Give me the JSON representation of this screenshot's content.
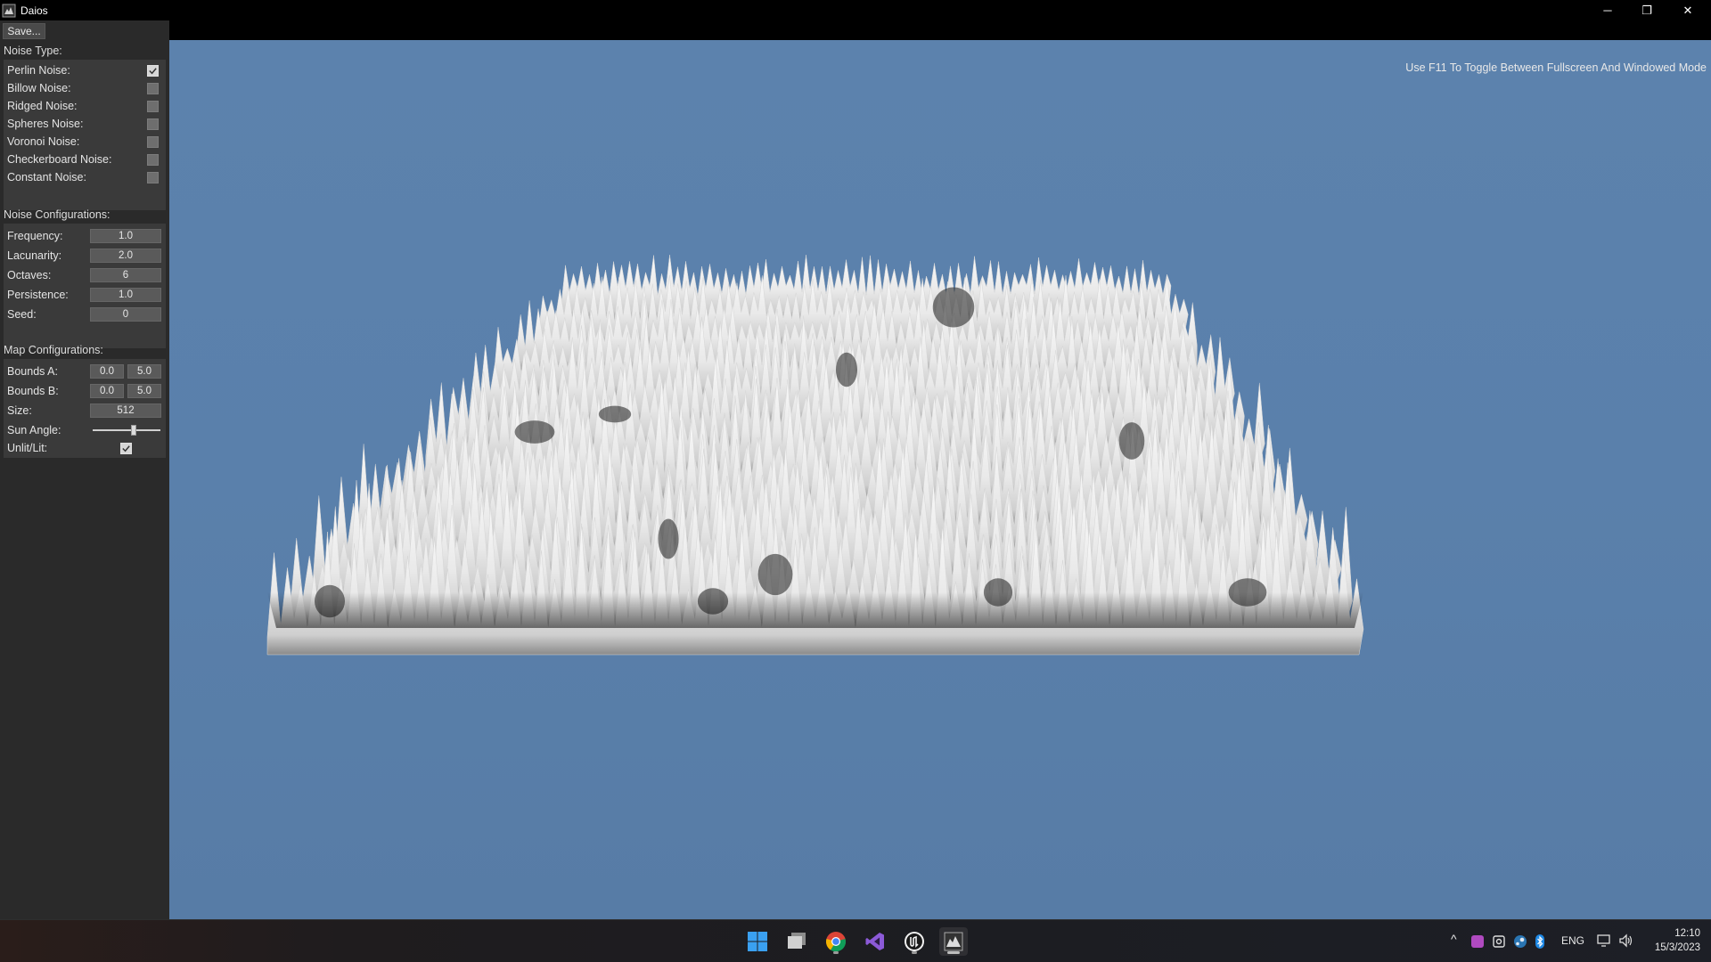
{
  "window": {
    "title": "Daios",
    "icon": "daios-app-icon",
    "controls": {
      "minimize": "─",
      "maximize": "❐",
      "close": "✕"
    }
  },
  "toolbar": {
    "save_label": "Save..."
  },
  "hint": "Use F11 To Toggle Between Fullscreen And Windowed Mode",
  "noise_type": {
    "title": "Noise Type:",
    "items": [
      {
        "label": "Perlin Noise:",
        "checked": true
      },
      {
        "label": "Billow Noise:",
        "checked": false
      },
      {
        "label": "Ridged Noise:",
        "checked": false
      },
      {
        "label": "Spheres Noise:",
        "checked": false
      },
      {
        "label": "Voronoi Noise:",
        "checked": false
      },
      {
        "label": "Checkerboard Noise:",
        "checked": false
      },
      {
        "label": "Constant Noise:",
        "checked": false
      }
    ]
  },
  "noise_config": {
    "title": "Noise Configurations:",
    "frequency": {
      "label": "Frequency:",
      "value": "1.0"
    },
    "lacunarity": {
      "label": "Lacunarity:",
      "value": "2.0"
    },
    "octaves": {
      "label": "Octaves:",
      "value": "6"
    },
    "persistence": {
      "label": "Persistence:",
      "value": "1.0"
    },
    "seed": {
      "label": "Seed:",
      "value": "0"
    }
  },
  "map_config": {
    "title": "Map Configurations:",
    "bounds_a": {
      "label": "Bounds A:",
      "min": "0.0",
      "max": "5.0"
    },
    "bounds_b": {
      "label": "Bounds B:",
      "min": "0.0",
      "max": "5.0"
    },
    "size": {
      "label": "Size:",
      "value": "512"
    },
    "sun_angle": {
      "label": "Sun Angle:",
      "level": 0.6
    },
    "unlit_lit": {
      "label": "Unlit/Lit:",
      "checked": true
    }
  },
  "colors": {
    "viewport_sky": "#5a80ab",
    "panel_bg": "#2a2a2a",
    "terrain_light": "#f4f4f4",
    "terrain_dark": "#151515"
  },
  "taskbar": {
    "icons": [
      "windows-start-icon",
      "file-explorer-icon",
      "chrome-icon",
      "visual-studio-icon",
      "unreal-engine-icon",
      "daios-app-icon"
    ],
    "tray": {
      "chevron": "^",
      "language": "ENG"
    },
    "clock": {
      "time": "12:10",
      "date": "15/3/2023"
    }
  }
}
